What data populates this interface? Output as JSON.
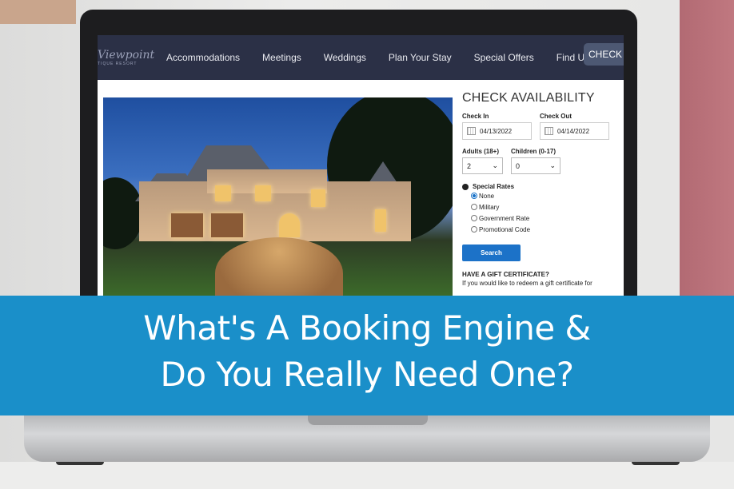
{
  "nav": {
    "logo": "Viewpoint",
    "logo_sub": "TIQUE RESORT",
    "items": [
      "Accommodations",
      "Meetings",
      "Weddings",
      "Plan Your Stay",
      "Special Offers",
      "Find Us"
    ],
    "cta": "CHECK AV"
  },
  "form": {
    "title": "CHECK AVAILABILITY",
    "check_in_label": "Check In",
    "check_in": "04/13/2022",
    "check_out_label": "Check Out",
    "check_out": "04/14/2022",
    "adults_label": "Adults (18+)",
    "adults": "2",
    "children_label": "Children (0-17)",
    "children": "0",
    "special_rates_label": "Special Rates",
    "rates": [
      "None",
      "Military",
      "Government Rate",
      "Promotional Code"
    ],
    "selected_rate": "None",
    "search": "Search",
    "gift_title": "HAVE A GIFT CERTIFICATE?",
    "gift_text": "If you would like to redeem a gift certificate for"
  },
  "banner": {
    "line1": "What's A Booking Engine &",
    "line2": "Do You Really Need One?"
  },
  "colors": {
    "banner": "#1a8fc9",
    "nav": "#2b3046",
    "button": "#1c72c8"
  }
}
